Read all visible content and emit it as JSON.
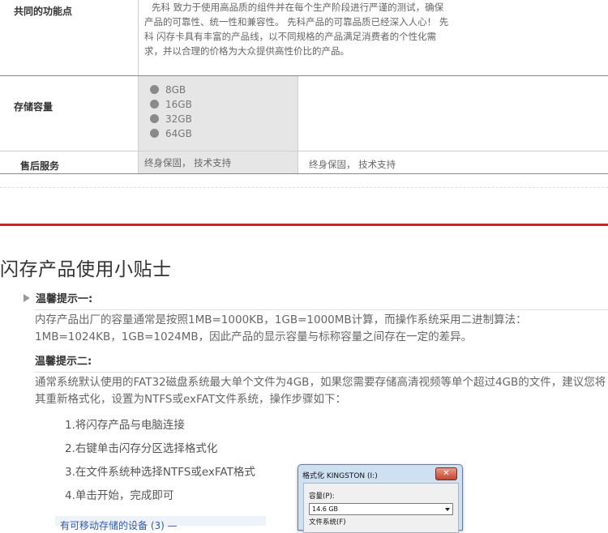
{
  "table": {
    "rows": [
      {
        "label": "共同的功能点",
        "text": "先科 致力于使用高品质的组件并在每个生产阶段进行严谨的测试，确保产品的可靠性、统一性和兼容性。 先科产品的可靠品质已经深入人心！ 先科 闪存卡具有丰富的产品线，以不同规格的产品满足消费者的个性化需求，并以合理的价格为大众提供高性价比的产品。"
      },
      {
        "label": "存储容量",
        "items": [
          "8GB",
          "16GB",
          "32GB",
          "64GB"
        ]
      },
      {
        "label": "售后服务",
        "col1": "终身保固， 技术支持",
        "col2": "终身保固， 技术支持"
      }
    ],
    "colors": {
      "gray_cell": "#e6e6e6",
      "accent_red": "#c8242b"
    }
  },
  "tips": {
    "title": "闪存产品使用小贴士",
    "tip1": {
      "heading": "温馨提示一:",
      "body": "内存产品出厂的容量通常是按照1MB=1000KB，1GB=1000MB计算，而操作系统采用二进制算法：1MB=1024KB，1GB=1024MB，因此产品的显示容量与标称容量之间存在一定的差异。"
    },
    "tip2": {
      "heading": "温馨提示二:",
      "body": "通常系统默认使用的FAT32磁盘系统最大单个文件为4GB，如果您需要存储高清视频等单个超过4GB的文件，建议您将其重新格式化，设置为NTFS或exFAT文件系统，操作步骤如下："
    },
    "steps": [
      "1.将闪存产品与电脑连接",
      "2.右键单击闪存分区选择格式化",
      "3.在文件系统种选择NTFS或exFAT格式",
      "4.单击开始，完成即可"
    ]
  },
  "format_dialog": {
    "title": "格式化 KINGSTON (I:)",
    "close_label": "✕",
    "capacity_label": "容量(P):",
    "capacity_value": "14.6 GB",
    "filesystem_label": "文件系统(F)"
  },
  "device_panel": {
    "link": "有可移动存储的设备 (3) —"
  }
}
